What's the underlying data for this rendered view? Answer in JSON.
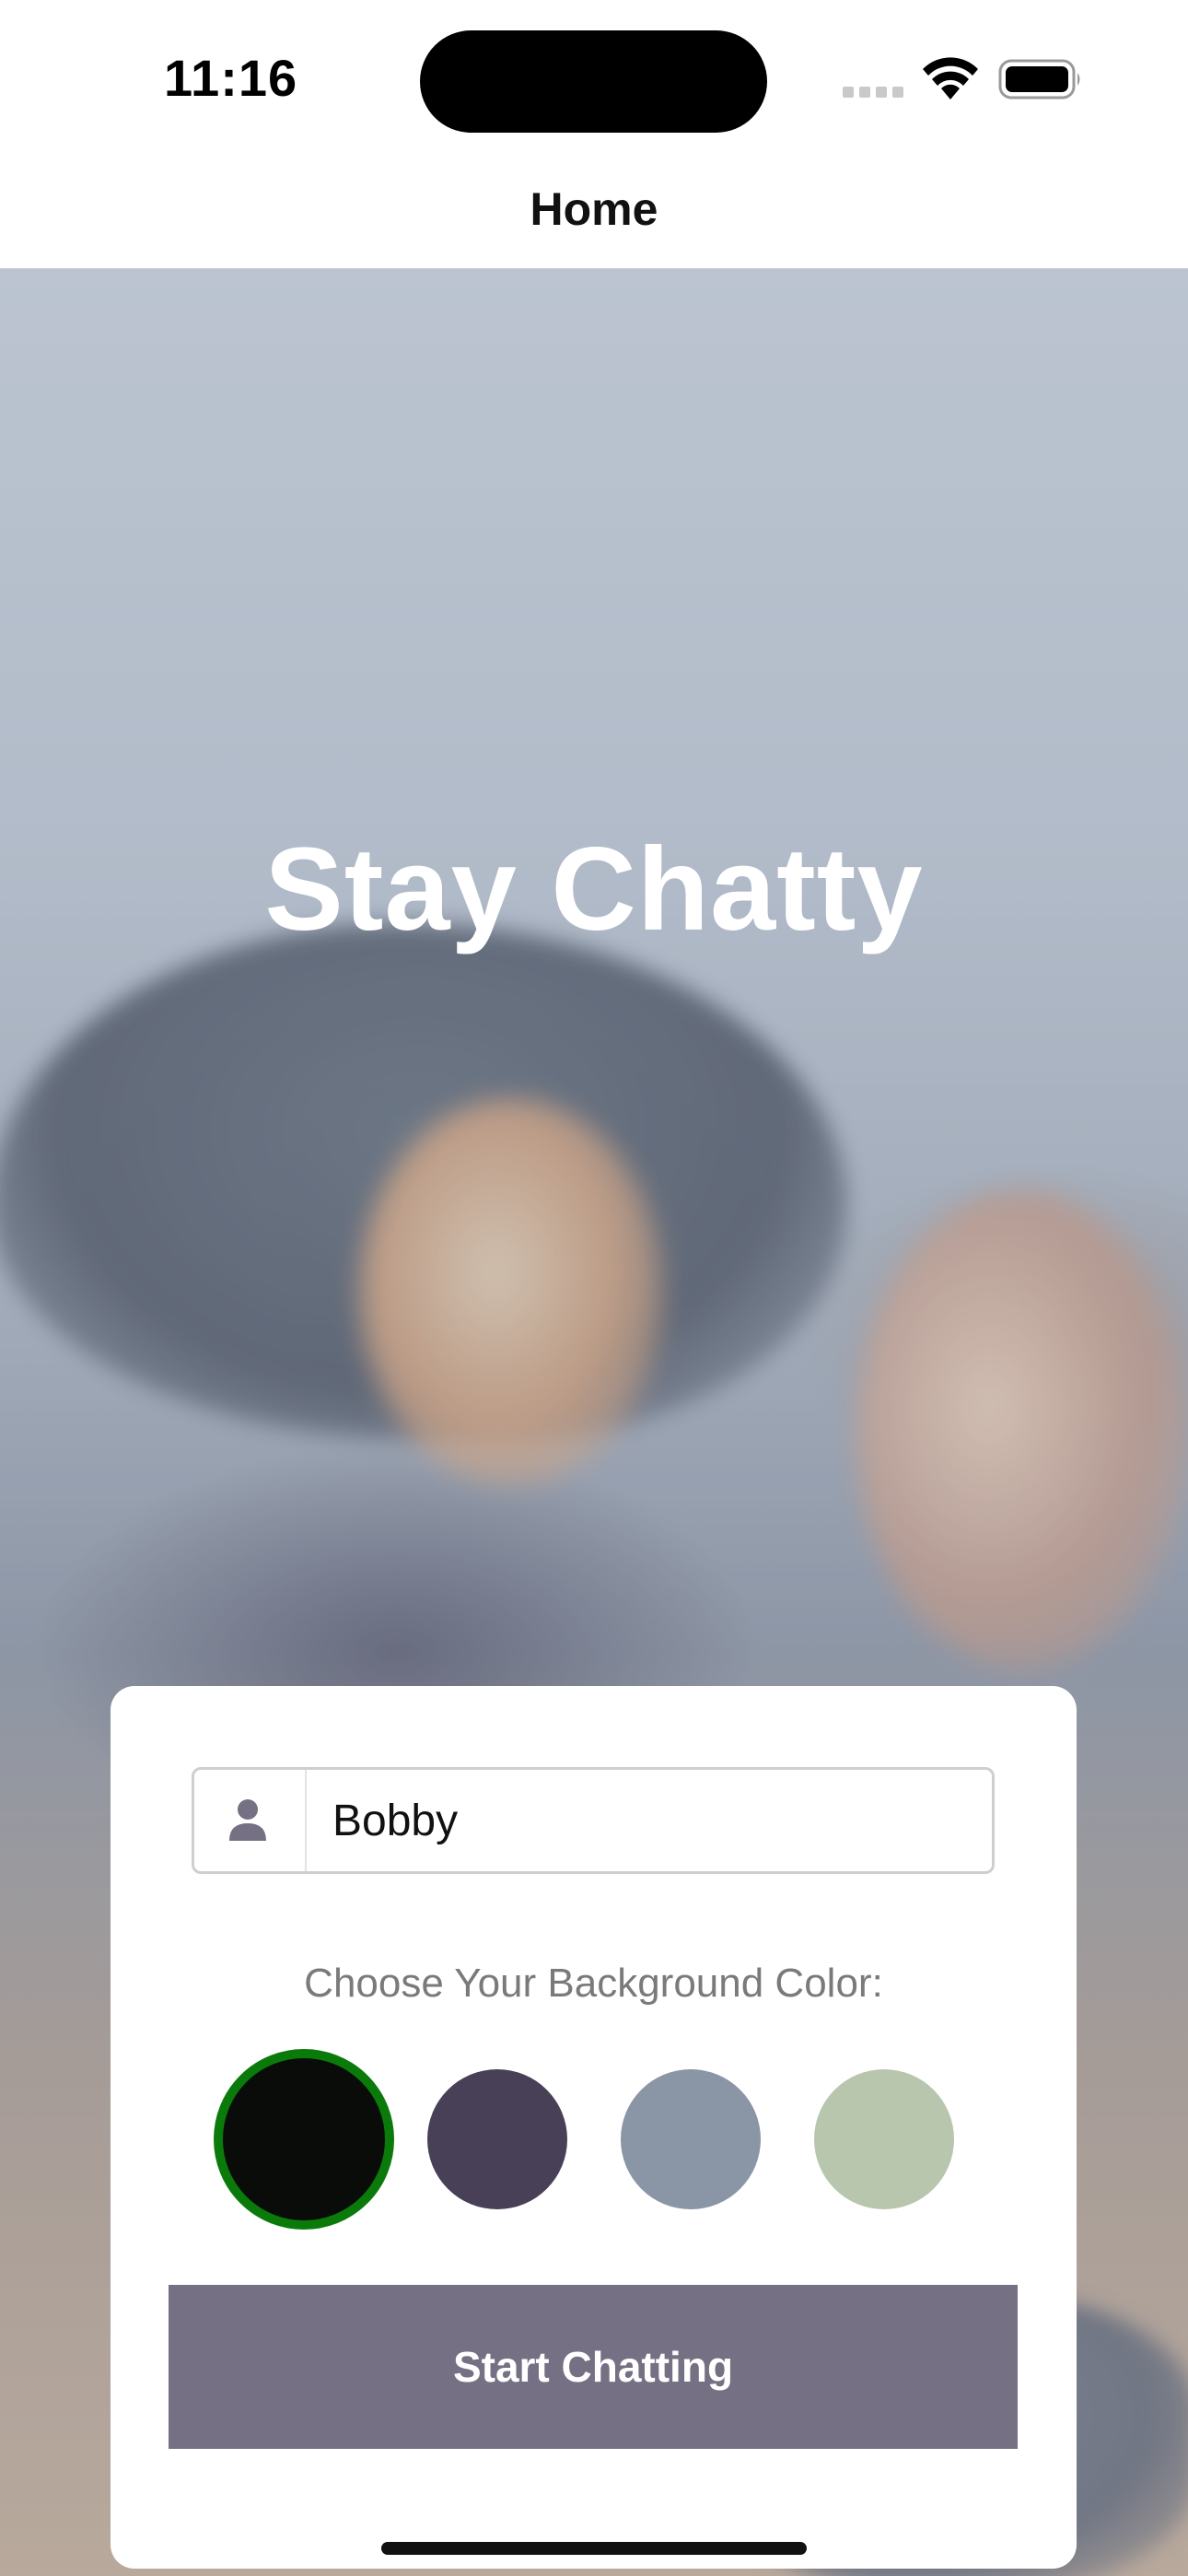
{
  "status_bar": {
    "time": "11:16"
  },
  "nav": {
    "title": "Home"
  },
  "main": {
    "title": "Stay Chatty"
  },
  "form": {
    "name_value": "Bobby",
    "name_icon": "person-icon",
    "color_label": "Choose Your Background Color:",
    "colors": [
      {
        "hex": "#090C08",
        "selected": true
      },
      {
        "hex": "#474056",
        "selected": false
      },
      {
        "hex": "#8A95A5",
        "selected": false
      },
      {
        "hex": "#B9C6AE",
        "selected": false
      }
    ],
    "selected_ring_color": "#0A7A0A",
    "start_button_label": "Start Chatting",
    "start_button_color": "#757083"
  }
}
